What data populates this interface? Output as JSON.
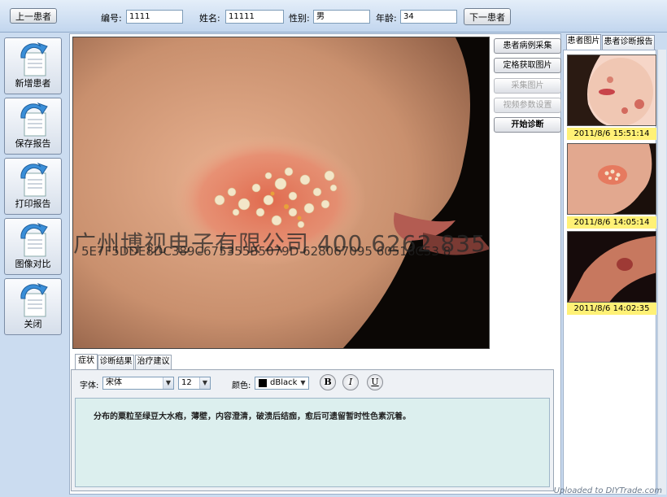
{
  "header": {
    "prev_button": "上一患者",
    "next_button": "下一患者",
    "fields": {
      "id_label": "编号:",
      "id_value": "1111",
      "name_label": "姓名:",
      "name_value": "11111",
      "gender_label": "性别:",
      "gender_value": "男",
      "age_label": "年龄:",
      "age_value": "34"
    }
  },
  "sidebar": {
    "items": [
      {
        "label": "新增患者"
      },
      {
        "label": "保存报告"
      },
      {
        "label": "打印报告"
      },
      {
        "label": "图像对比"
      },
      {
        "label": "关闭"
      }
    ]
  },
  "actions": {
    "collect_case": "患者病例采集",
    "capture_frame": "定格获取图片",
    "capture_image": "采集图片",
    "video_settings": "视频参数设置",
    "start_diagnosis": "开始诊断"
  },
  "watermark": {
    "company": "广州博视电子有限公司 400 6262 835",
    "code": "5E7F5DDE8DC389C675355B5079D 628067095 60516C53 8"
  },
  "tabs": [
    {
      "label": "症状"
    },
    {
      "label": "诊断结果"
    },
    {
      "label": "治疗建议"
    }
  ],
  "editor": {
    "font_label": "字体:",
    "font_value": "宋体",
    "size_value": "12",
    "color_label": "颜色:",
    "color_value": "dBlack",
    "color_swatch": "#000000",
    "bold": "B",
    "italic": "I",
    "underline": "U",
    "content": "分布的粟粒至绿豆大水疱，薄壁，内容澄清，破溃后结痂，愈后可遗留暂时性色素沉着。"
  },
  "right_panel": {
    "tabs": [
      {
        "label": "患者图片"
      },
      {
        "label": "患者诊断报告"
      }
    ],
    "images": [
      {
        "timestamp": "2011/8/6 15:51:14"
      },
      {
        "timestamp": "2011/8/6 14:05:14"
      },
      {
        "timestamp": "2011/8/6 14:02:35"
      }
    ]
  },
  "footer": {
    "watermark": "Uploaded to DIYTrade.com"
  }
}
